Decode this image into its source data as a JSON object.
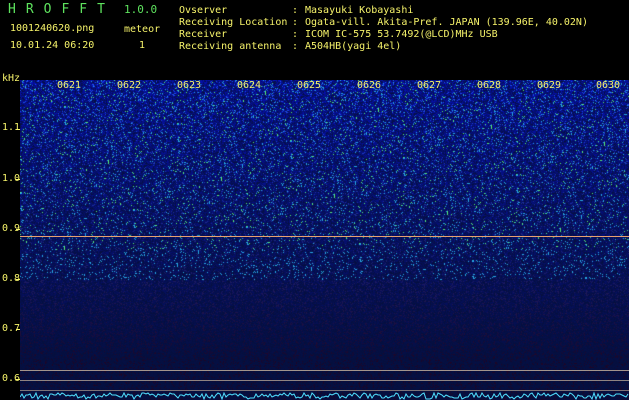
{
  "header": {
    "logo": "HROFFT",
    "version": "1.0.0",
    "filename": "1001240620.png",
    "mode": "meteor",
    "timestamp": "10.01.24 06:20",
    "count": "1"
  },
  "info": [
    {
      "label": "Ovserver",
      "value": "Masayuki Kobayashi"
    },
    {
      "label": "Receiving Location",
      "value": "Ogata-vill. Akita-Pref. JAPAN (139.96E, 40.02N)"
    },
    {
      "label": "Receiver",
      "value": "ICOM IC-575 53.7492(@LCD)MHz USB"
    },
    {
      "label": "Receiving antenna",
      "value": "A504HB(yagi 4el)"
    }
  ],
  "axis": {
    "unit": "kHz",
    "y_ticks": [
      "1.1",
      "1.0",
      "0.9",
      "0.8",
      "0.7",
      "0.6"
    ],
    "time_ticks": [
      "0621",
      "0622",
      "0623",
      "0624",
      "0625",
      "0626",
      "0627",
      "0628",
      "0629",
      "0630"
    ]
  },
  "colors": {
    "text": "#f6f36a",
    "logo": "#5ee35e",
    "carrier_line": "#e8a070",
    "bottom_trace": "#50e0ff"
  }
}
